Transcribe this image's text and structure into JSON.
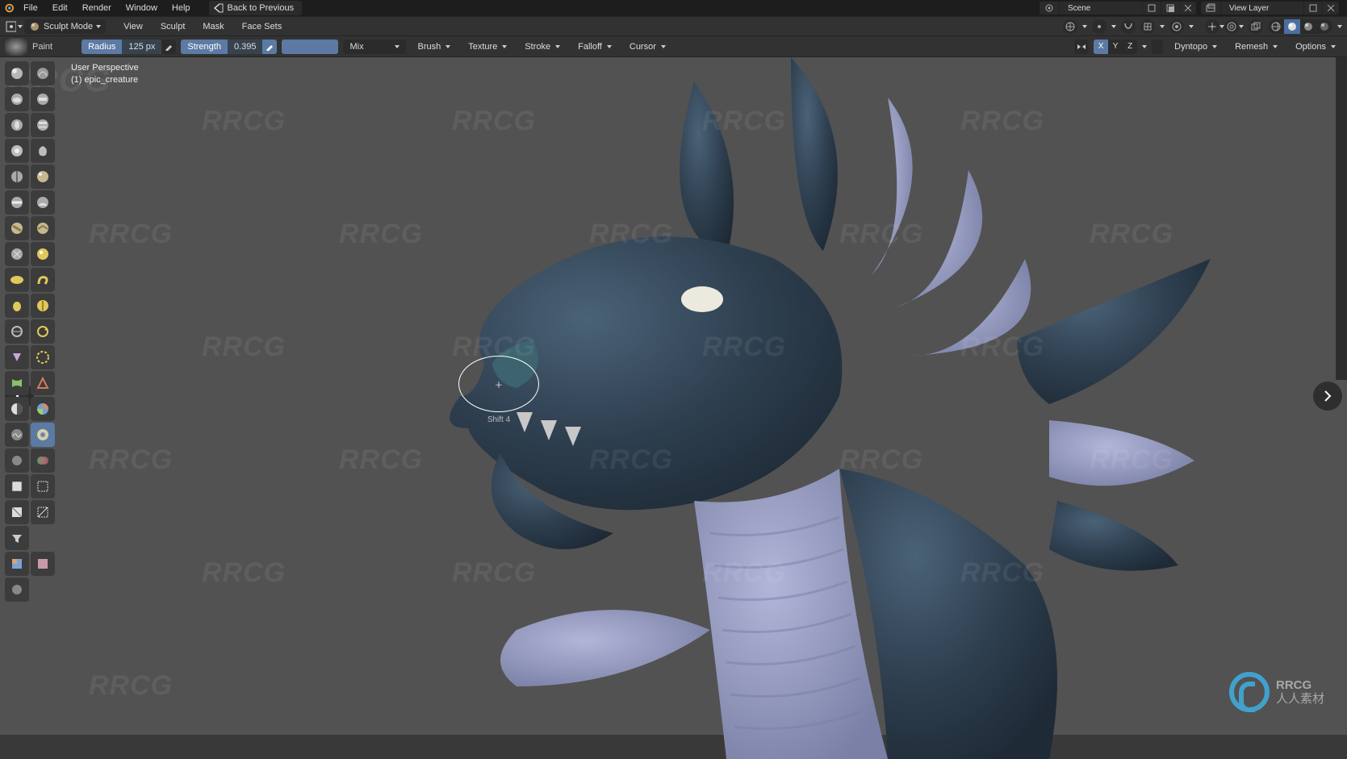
{
  "topmenu": {
    "items": [
      "File",
      "Edit",
      "Render",
      "Window",
      "Help"
    ],
    "back_to_previous": "Back to Previous",
    "scene_label": "Scene",
    "viewlayer_label": "View Layer"
  },
  "header": {
    "mode": "Sculpt Mode",
    "menus": [
      "View",
      "Sculpt",
      "Mask",
      "Face Sets"
    ]
  },
  "tool": {
    "name": "Paint",
    "radius_label": "Radius",
    "radius_value": "125 px",
    "strength_label": "Strength",
    "strength_value": "0.395",
    "blend": "Mix",
    "dropdowns": [
      "Brush",
      "Texture",
      "Stroke",
      "Falloff",
      "Cursor"
    ],
    "axis": [
      "X",
      "Y",
      "Z"
    ],
    "right_dd": [
      "Dyntopo",
      "Remesh",
      "Options"
    ],
    "color": "#5c7aa3"
  },
  "viewport": {
    "persp": "User Perspective",
    "obj": "(1) epic_creature",
    "brush_tip": "Shift 4"
  },
  "toolbar": {
    "tools_left_col": [
      "draw",
      "draw-sharp",
      "clay",
      "clay-strips",
      "clay-thumb",
      "layer",
      "inflate",
      "blob",
      "crease",
      "smooth",
      "flatten",
      "fill",
      "scrape",
      "multi-plane-scrape",
      "pinch",
      "grab",
      "elastic-deform",
      "snake-hook",
      "thumb",
      "pose",
      "nudge",
      "rotate",
      "slide-relax",
      "boundary",
      "cloth",
      "simplify",
      "mask",
      "draw-face-sets",
      "multires-displacement",
      "paint",
      "smear",
      "box-mask",
      "box-hide",
      "box-trim",
      "line-project",
      "mesh-filter",
      "cloth-filter",
      "color-filter",
      "edit-face-set",
      "mask-by-color"
    ],
    "active": "paint"
  },
  "watermark": {
    "text": "RRCG",
    "brand_cn": "人人素材",
    "brand_en": "RRCG"
  }
}
